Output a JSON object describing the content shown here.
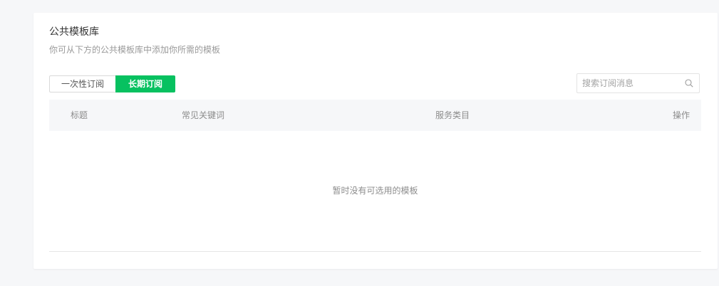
{
  "panel": {
    "title": "公共模板库",
    "subtitle": "你可从下方的公共模板库中添加你所需的模板"
  },
  "tabs": [
    {
      "label": "一次性订阅",
      "active": false
    },
    {
      "label": "长期订阅",
      "active": true
    }
  ],
  "search": {
    "placeholder": "搜索订阅消息",
    "value": "",
    "icon": "search-icon"
  },
  "table": {
    "columns": [
      "标题",
      "常见关键词",
      "服务类目",
      "操作"
    ],
    "rows": [],
    "empty_text": "暂时没有可选用的模板"
  },
  "colors": {
    "accent": "#07c160",
    "background": "#f6f7f9"
  }
}
